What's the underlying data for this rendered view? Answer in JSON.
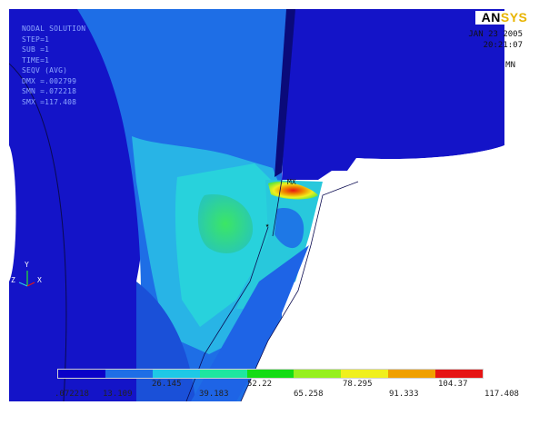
{
  "window": {
    "logo_an": "AN",
    "logo_sys": "SYS",
    "date": "JAN 23 2005",
    "time": "20:21:07",
    "mn_label": "MN",
    "mx_label": "MX"
  },
  "info_block": [
    "NODAL SOLUTION",
    "STEP=1",
    "SUB =1",
    "TIME=1",
    "SEQV (AVG)",
    "DMX =.002799",
    "SMN =.072218",
    "SMX =117.408"
  ],
  "triad": {
    "y": "Y",
    "z": "Z",
    "x": "X"
  },
  "legend": {
    "colors": [
      "#0a00c8",
      "#1e6ee6",
      "#1ec8e6",
      "#1ee6a0",
      "#14dc14",
      "#96f01e",
      "#f0f01e",
      "#f0a000",
      "#e61414"
    ],
    "labels_bottom": [
      ".072218",
      "13.109",
      "39.183",
      "65.258",
      "91.333",
      "117.408"
    ],
    "labels_top": [
      "26.145",
      "52.22",
      "78.295",
      "104.37"
    ]
  },
  "accent_colors": {
    "background": "#ffffff",
    "deep_blue": "#1a1ad2",
    "mid_blue": "#1e78e6",
    "cyan": "#28c8e6",
    "green": "#28e696",
    "red": "#e61414"
  }
}
